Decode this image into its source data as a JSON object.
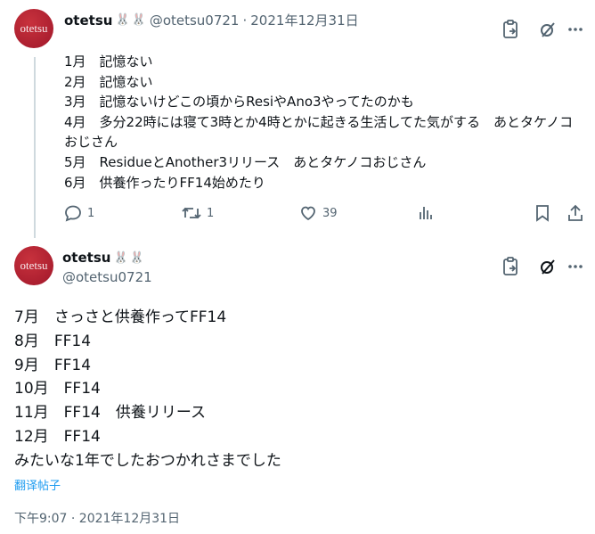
{
  "tweet1": {
    "avatar_text": "otetsu",
    "display_name": "otetsu",
    "emojis": [
      "🐰",
      "🐰"
    ],
    "handle": "@otetsu0721",
    "separator": "·",
    "date": "2021年12月31日",
    "lines": [
      "1月　記憶ない",
      "2月　記憶ない",
      "3月　記憶ないけどこの頃からResiやAno3やってたのかも",
      "4月　多分22時には寝て3時とか4時とかに起きる生活してた気がする　あとタケノコおじさん",
      "5月　ResidueとAnother3リリース　あとタケノコおじさん",
      "6月　供養作ったりFF14始めたり"
    ],
    "actions": {
      "reply_count": "1",
      "retweet_count": "1",
      "like_count": "39"
    }
  },
  "tweet2": {
    "avatar_text": "otetsu",
    "display_name": "otetsu",
    "emojis": [
      "🐰",
      "🐰"
    ],
    "handle": "@otetsu0721",
    "lines": [
      "7月　さっさと供養作ってFF14",
      "8月　FF14",
      "9月　FF14",
      "10月　FF14",
      "11月　FF14　供養リリース",
      "12月　FF14",
      "みたいな1年でしたおつかれさまでした"
    ],
    "translate_link": "翻译帖子",
    "timestamp": "下午9:07 · 2021年12月31日"
  },
  "icons": {
    "clipboard_link": "clipboard-link-icon",
    "grok": "grok-icon",
    "more": "more-icon",
    "reply": "reply-icon",
    "retweet": "retweet-icon",
    "like": "like-icon",
    "views": "views-icon",
    "bookmark": "bookmark-icon",
    "share": "share-icon"
  },
  "colors": {
    "text": "#0f1419",
    "muted": "#536471",
    "link": "#1d9bf0",
    "avatar": "#a0172a",
    "thread_line": "#cfd9de"
  }
}
